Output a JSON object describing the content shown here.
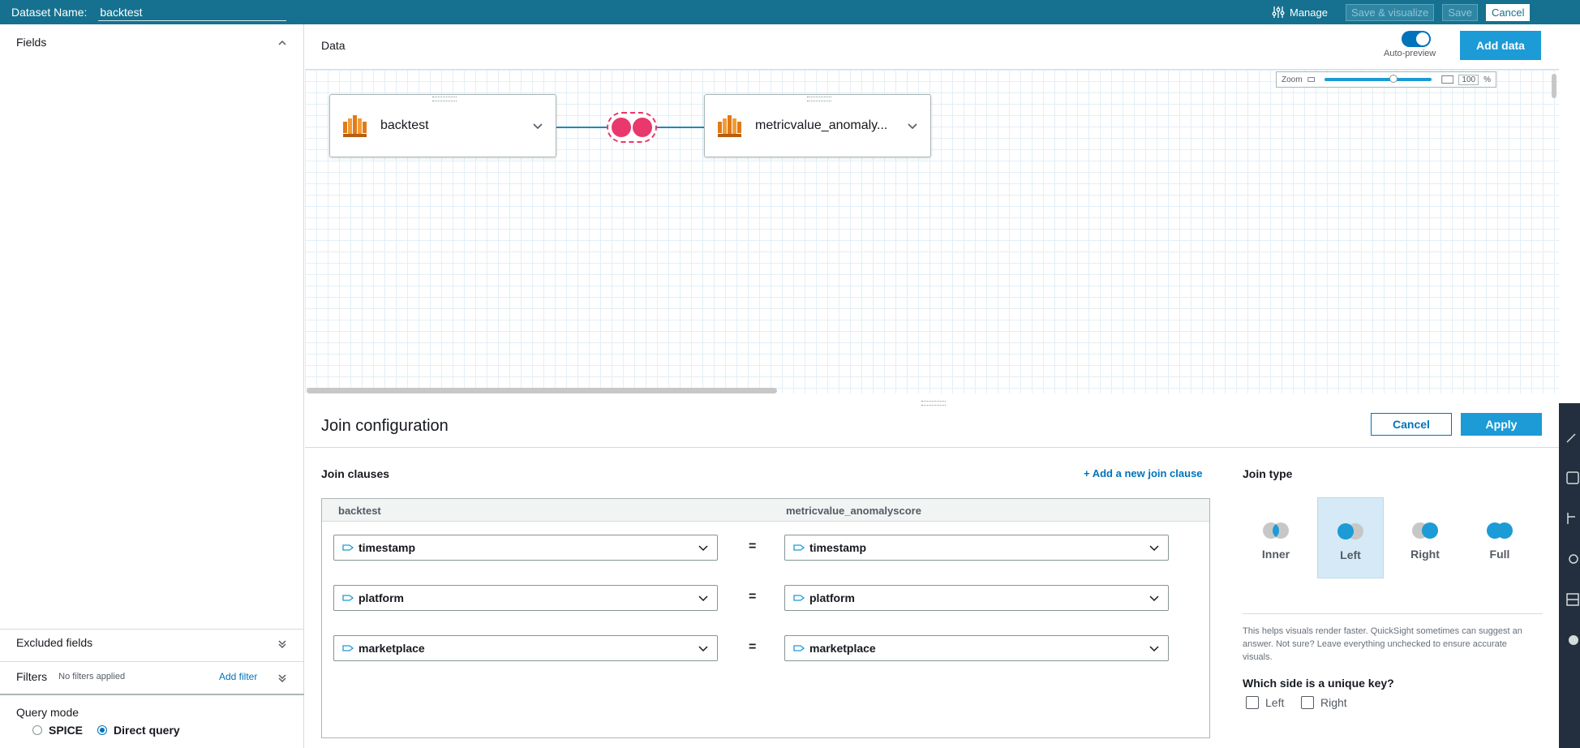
{
  "topbar": {
    "dataset_name_label": "Dataset Name:",
    "dataset_name_value": "backtest",
    "manage_label": "Manage",
    "save_visualize_label": "Save & visualize",
    "save_label": "Save",
    "cancel_label": "Cancel"
  },
  "left_panel": {
    "fields_title": "Fields",
    "excluded_fields": "Excluded fields",
    "filters_title": "Filters",
    "filters_status": "No filters applied",
    "add_filter": "Add filter",
    "query_mode_title": "Query mode",
    "query_mode_options": [
      "SPICE",
      "Direct query"
    ],
    "query_mode_selected": "Direct query"
  },
  "data_header": {
    "title": "Data",
    "auto_preview_label": "Auto-preview",
    "auto_preview_on": true,
    "add_data_label": "Add data"
  },
  "canvas": {
    "zoom_label": "Zoom",
    "zoom_value": "100",
    "zoom_unit": "%",
    "nodes": [
      {
        "label": "backtest"
      },
      {
        "label": "metricvalue_anomaly..."
      }
    ],
    "join_colors": {
      "line": "#1f8ab8",
      "badge": "#e8386c"
    }
  },
  "join_config": {
    "title": "Join configuration",
    "cancel_label": "Cancel",
    "apply_label": "Apply",
    "clauses_title": "Join clauses",
    "add_clause_label": "+ Add a new join clause",
    "left_table": "backtest",
    "right_table": "metricvalue_anomalyscore",
    "clauses": [
      {
        "left": "timestamp",
        "op": "=",
        "right": "timestamp"
      },
      {
        "left": "platform",
        "op": "=",
        "right": "platform"
      },
      {
        "left": "marketplace",
        "op": "=",
        "right": "marketplace"
      }
    ],
    "join_type_title": "Join type",
    "join_types": [
      "Inner",
      "Left",
      "Right",
      "Full"
    ],
    "join_type_selected": "Left",
    "help_text": "This helps visuals render faster. QuickSight sometimes can suggest an answer. Not sure? Leave everything unchecked to ensure accurate visuals.",
    "unique_key_title": "Which side is a unique key?",
    "unique_key_options": [
      "Left",
      "Right"
    ]
  },
  "colors": {
    "topbar": "#15718f",
    "primary": "#1c9bd6",
    "link": "#0073bb",
    "join_badge": "#e8386c"
  }
}
